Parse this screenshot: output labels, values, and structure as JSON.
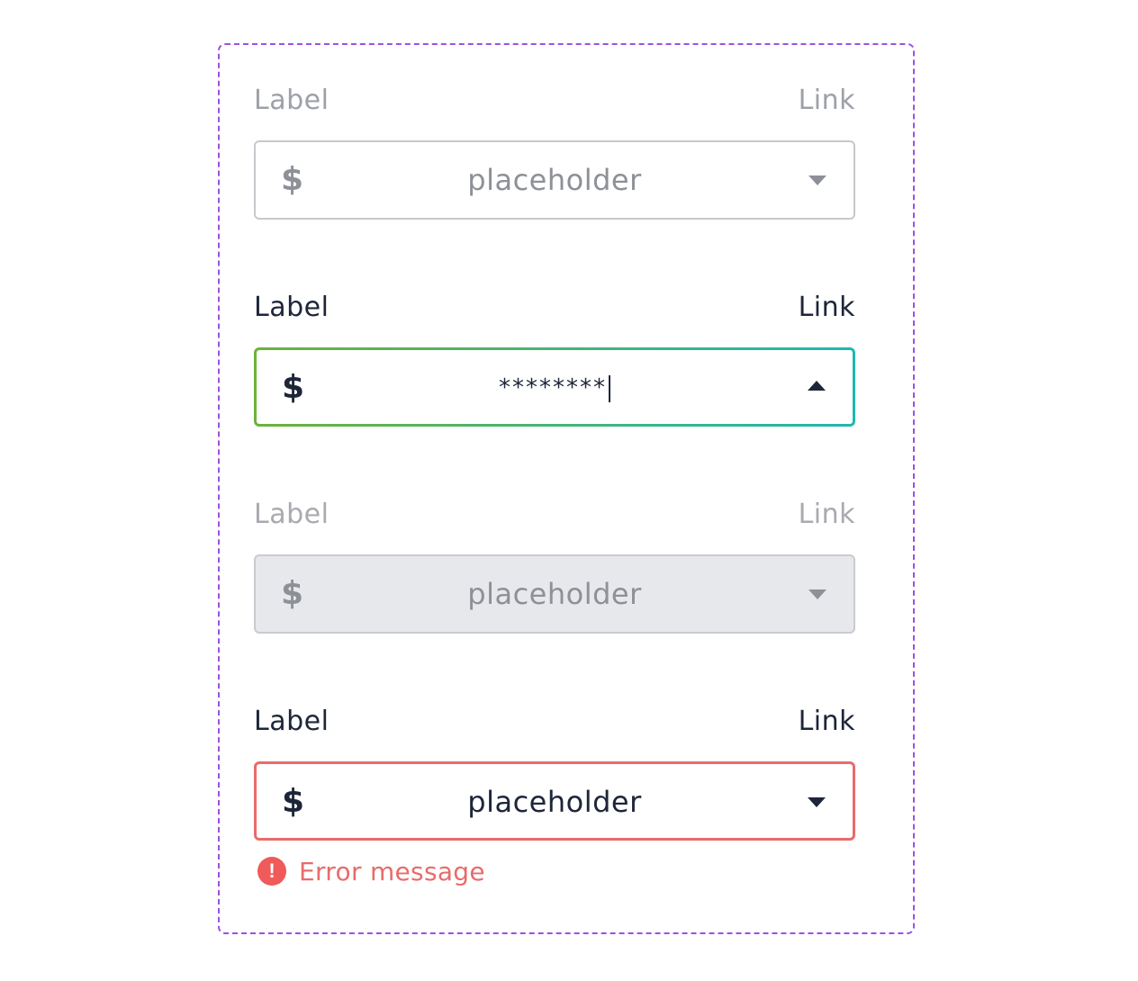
{
  "fields": [
    {
      "state": "default",
      "label": "Label",
      "link": "Link",
      "prefix": "$",
      "value": "placeholder",
      "dropdown": "closed"
    },
    {
      "state": "focused",
      "label": "Label",
      "link": "Link",
      "prefix": "$",
      "value": "********",
      "dropdown": "open"
    },
    {
      "state": "disabled",
      "label": "Label",
      "link": "Link",
      "prefix": "$",
      "value": "placeholder",
      "dropdown": "closed"
    },
    {
      "state": "error",
      "label": "Label",
      "link": "Link",
      "prefix": "$",
      "value": "placeholder",
      "dropdown": "closed",
      "error_icon": "!",
      "error_message": "Error message"
    }
  ],
  "colors": {
    "frame_dashed": "#9b51e0",
    "text_dark": "#1d2639",
    "text_muted": "#9ea0a8",
    "focus_gradient_start": "#6cb23a",
    "focus_gradient_end": "#1fb8b0",
    "disabled_bg": "#e7e8eb",
    "error": "#e96b6b"
  },
  "icons": {
    "prefix": "dollar-icon",
    "dropdown_closed": "caret-down-icon",
    "dropdown_open": "caret-up-icon",
    "error": "error-alert-icon"
  }
}
